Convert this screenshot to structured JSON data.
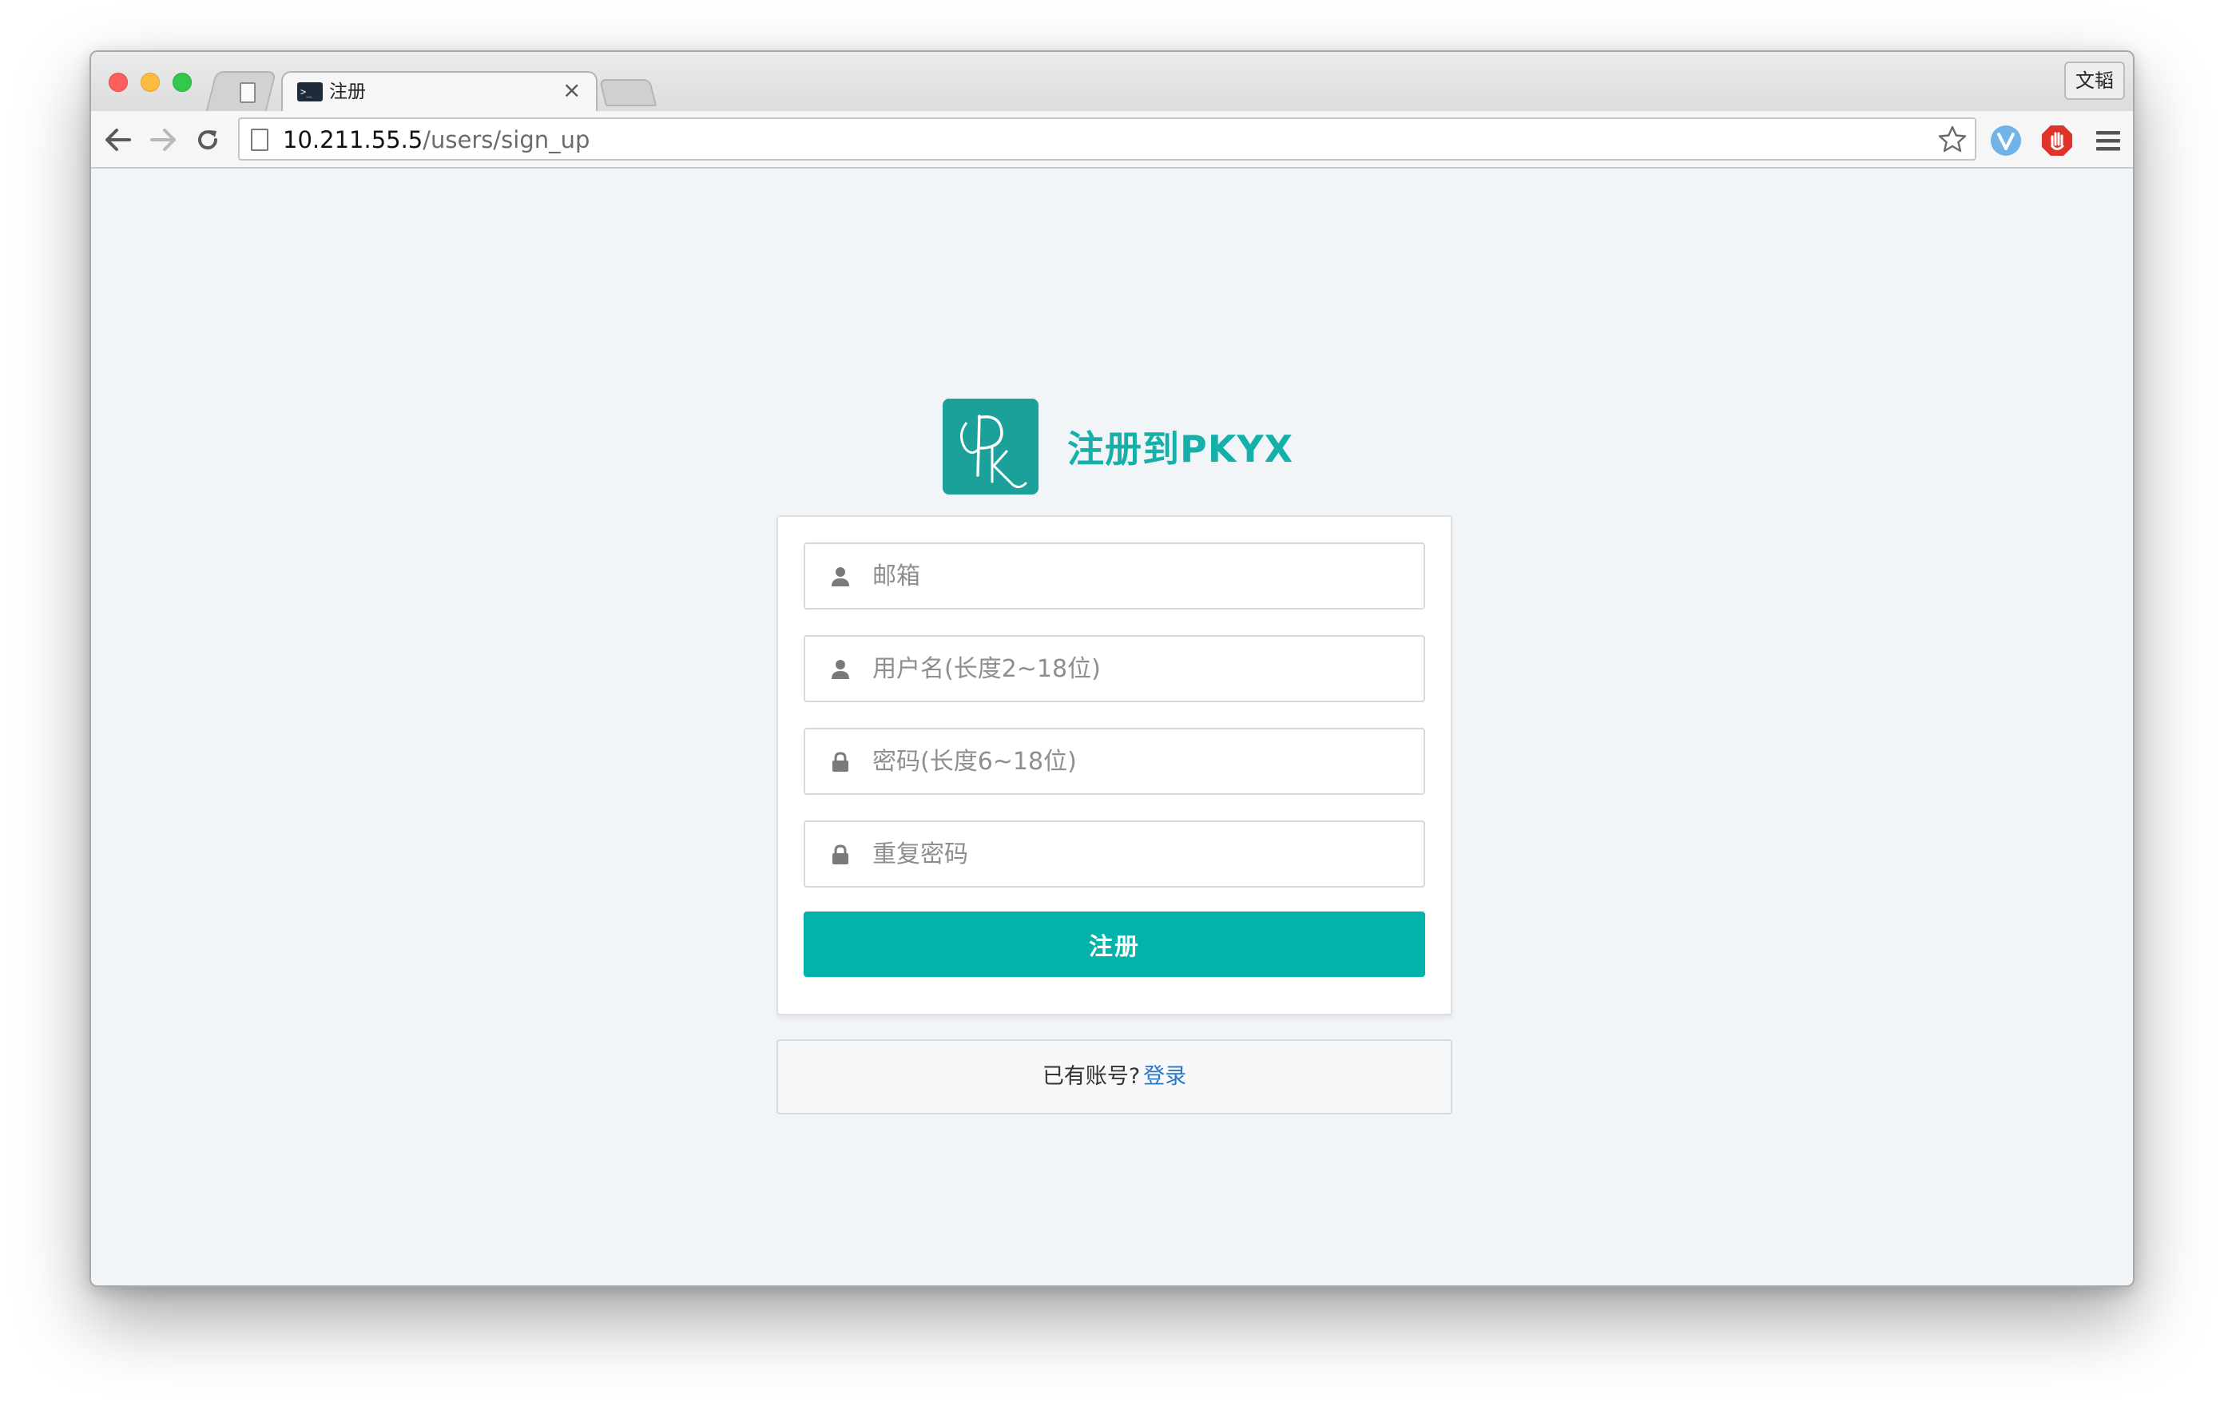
{
  "browser": {
    "tab": {
      "title": "注册",
      "close_glyph": "×",
      "favicon": "terminal-icon"
    },
    "profile_label": "文韬",
    "url": {
      "host": "10.211.55.5",
      "path": "/users/sign_up"
    },
    "toolbar_icons": [
      "back-arrow-icon",
      "forward-arrow-icon",
      "reload-icon",
      "page-icon",
      "star-icon",
      "vue-devtools-icon",
      "adblock-stop-icon",
      "menu-icon"
    ]
  },
  "page": {
    "brand": {
      "title": "注册到PKYX",
      "logo_mark": "PK"
    },
    "form": {
      "email_placeholder": "邮箱",
      "username_placeholder": "用户名(长度2~18位)",
      "password_placeholder": "密码(长度6~18位)",
      "password_confirm_placeholder": "重复密码",
      "submit_label": "注册"
    },
    "login_prompt": {
      "text": "已有账号?",
      "link_label": "登录"
    }
  },
  "colors": {
    "accent": "#03b2aa",
    "brand_text": "#15b0aa",
    "logo_bg": "#1ba19a",
    "link": "#2a78c9",
    "page_bg": "#f2f5f8"
  }
}
